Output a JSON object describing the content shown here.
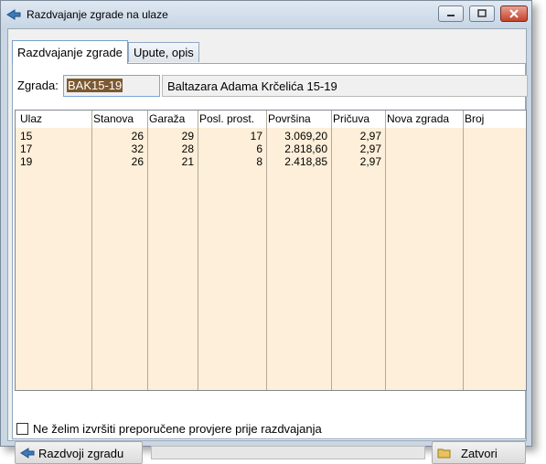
{
  "window": {
    "title": "Razdvajanje zgrade na ulaze"
  },
  "tabs": [
    {
      "label": "Razdvajanje zgrade"
    },
    {
      "label": "Upute, opis"
    }
  ],
  "building": {
    "label": "Zgrada:",
    "code": "BAK15-19",
    "name": "Baltazara Adama Krčelića 15-19"
  },
  "table": {
    "columns": [
      "Ulaz",
      "Stanova",
      "Garaža",
      "Posl. prost.",
      "Površina",
      "Pričuva",
      "Nova zgrada",
      "Broj"
    ],
    "rows": [
      [
        "15",
        "26",
        "29",
        "17",
        "3.069,20",
        "2,97",
        "",
        ""
      ],
      [
        "17",
        "32",
        "28",
        "6",
        "2.818,60",
        "2,97",
        "",
        ""
      ],
      [
        "19",
        "26",
        "21",
        "8",
        "2.418,85",
        "2,97",
        "",
        ""
      ]
    ]
  },
  "options": {
    "skip_checks_label": "Ne želim izvršiti preporučene provjere prije razdvajanja",
    "skip_checks": false
  },
  "progress": {
    "value": 0
  },
  "buttons": {
    "split": "Razdvoji zgradu",
    "close": "Zatvori"
  }
}
